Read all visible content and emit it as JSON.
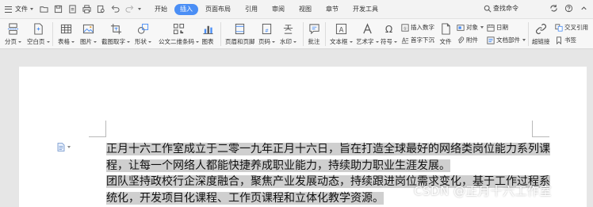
{
  "tabbar": {
    "file_label": "文件",
    "tabs": [
      "开始",
      "插入",
      "页面布局",
      "引用",
      "审阅",
      "视图",
      "章节",
      "开发工具"
    ],
    "active_tab": "插入",
    "search_label": "查找命令"
  },
  "ribbon": {
    "page_break": "分页",
    "blank_page": "空白页",
    "table": "表格",
    "picture": "图片",
    "screenshot_text": "截图取字",
    "shapes": "形状",
    "formula_code": "公文二维条码",
    "chart": "图表",
    "header_footer": "页眉和页脚",
    "page_number": "页码",
    "watermark": "水印",
    "comment": "批注",
    "textbox": "文本框",
    "art_text": "艺术字",
    "symbol": "符号",
    "insert_number": "插入数字",
    "drop_cap": "首字下沉",
    "file": "文件",
    "object": "对象",
    "attachment": "附件",
    "date": "日期",
    "doc_parts": "文档部件",
    "hyperlink": "超链接",
    "cross_ref": "交叉引用",
    "bookmark": "书签"
  },
  "document": {
    "lines": [
      "正月十六工作室成立于二零一九年正月十六日，旨在打造全球最好的网络类岗位能力系列课",
      "程，让每一个网络人都能快捷养成职业能力，持续助力职业生涯发展。",
      "团队坚持政校行企深度融合，聚焦产业发展动态，持续跟进岗位需求变化，基于工作过程系",
      "统化，开发项目化课程、工作页课程和立体化教学资源。"
    ]
  },
  "watermark_text": "CSDN @正月十六工作室"
}
